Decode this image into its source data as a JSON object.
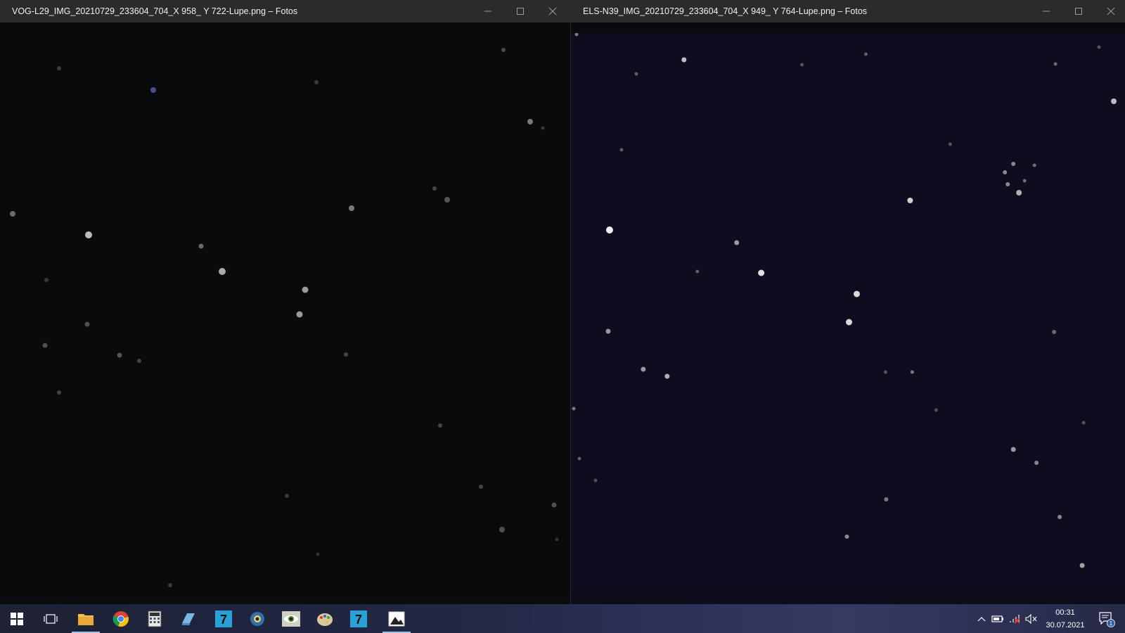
{
  "windows": [
    {
      "title": "VOG-L29_IMG_20210729_233604_704_X 958_ Y 722-Lupe.png – Fotos",
      "app": "Fotos"
    },
    {
      "title": "ELS-N39_IMG_20210729_233604_704_X 949_ Y 764-Lupe.png – Fotos",
      "app": "Fotos"
    }
  ],
  "caption_buttons": [
    "minimize-icon",
    "maximize-icon",
    "close-icon"
  ],
  "taskbar": {
    "apps": [
      {
        "name": "start",
        "icon": "windows-logo-icon"
      },
      {
        "name": "task-view",
        "icon": "task-view-icon"
      },
      {
        "name": "file-explorer",
        "icon": "folder-icon",
        "active": true
      },
      {
        "name": "chrome",
        "icon": "chrome-icon"
      },
      {
        "name": "calculator",
        "icon": "calculator-icon"
      },
      {
        "name": "app-blue-book",
        "icon": "book-icon"
      },
      {
        "name": "app-seven",
        "icon": "seven-icon"
      },
      {
        "name": "app-globe-camera",
        "icon": "globe-camera-icon"
      },
      {
        "name": "app-eye",
        "icon": "eye-icon"
      },
      {
        "name": "app-palette",
        "icon": "palette-icon"
      },
      {
        "name": "app-seven-2",
        "icon": "seven-icon"
      },
      {
        "name": "photos",
        "icon": "photos-icon",
        "active": true
      }
    ],
    "tray": [
      "chevron-up-icon",
      "battery-icon",
      "network-off-icon",
      "volume-muted-icon"
    ],
    "clock": {
      "time": "00:31",
      "date": "30.07.2021"
    },
    "notifications": {
      "count": "1"
    }
  },
  "colors": {
    "titlebar": "#2b2b2b",
    "taskbar": "#222743",
    "left_photo_bg": "#080a0c",
    "right_photo_bg": "#0e0d1f",
    "accent": "#9fc3e8"
  }
}
